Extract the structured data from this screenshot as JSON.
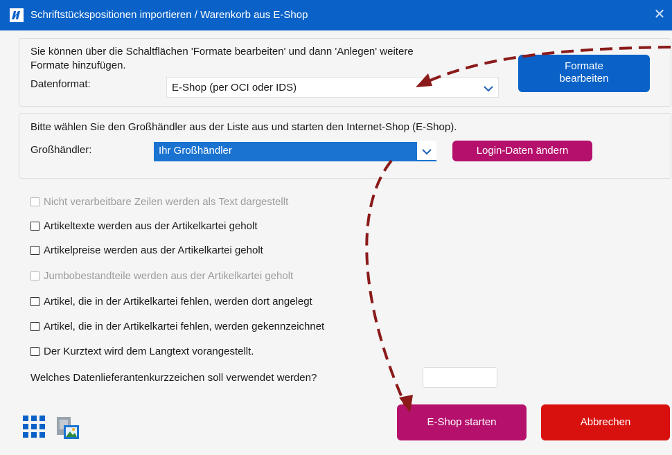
{
  "window": {
    "title": "Schriftstückspositionen importieren / Warenkorb aus E-Shop",
    "accent_color": "#0a62c8",
    "close_icon": "close-icon"
  },
  "format_group": {
    "info_line1": "Sie können über die Schaltflächen 'Formate bearbeiten' und dann 'Anlegen' weitere",
    "info_line2": "Formate hinzufügen.",
    "datenformat_label": "Datenformat:",
    "datenformat_value": "E-Shop (per OCI oder IDS)",
    "formate_button_line1": "Formate",
    "formate_button_line2": "bearbeiten"
  },
  "dealer_group": {
    "info": "Bitte wählen Sie den Großhändler aus der Liste aus und starten den Internet-Shop (E-Shop).",
    "grosshaendler_label": "Großhändler:",
    "grosshaendler_value": "Ihr Großhändler",
    "login_button": "Login-Daten ändern"
  },
  "options": [
    {
      "label": "Nicht verarbeitbare Zeilen werden als Text dargestellt",
      "checked": false,
      "disabled": true
    },
    {
      "label": "Artikeltexte werden aus der Artikelkartei geholt",
      "checked": false,
      "disabled": false
    },
    {
      "label": "Artikelpreise werden aus der Artikelkartei geholt",
      "checked": false,
      "disabled": false
    },
    {
      "label": "Jumbobestandteile werden aus der Artikelkartei geholt",
      "checked": false,
      "disabled": true
    },
    {
      "label": "Artikel, die in der Artikelkartei fehlen, werden dort angelegt",
      "checked": false,
      "disabled": false
    },
    {
      "label": "Artikel, die in der Artikelkartei fehlen, werden gekennzeichnet",
      "checked": false,
      "disabled": false
    },
    {
      "label": "Der Kurztext wird dem Langtext vorangestellt.",
      "checked": false,
      "disabled": false
    }
  ],
  "supplier_code": {
    "label": "Welches Datenlieferantenkurzzeichen soll verwendet werden?",
    "value": ""
  },
  "footer": {
    "start_button": "E-Shop starten",
    "cancel_button": "Abbrechen",
    "start_color": "#b5106c",
    "cancel_color": "#d8110f",
    "grid_icon": "grid-icon",
    "image_icon": "image-icon"
  },
  "annotation": {
    "arrow_color": "#8b1a1a"
  }
}
